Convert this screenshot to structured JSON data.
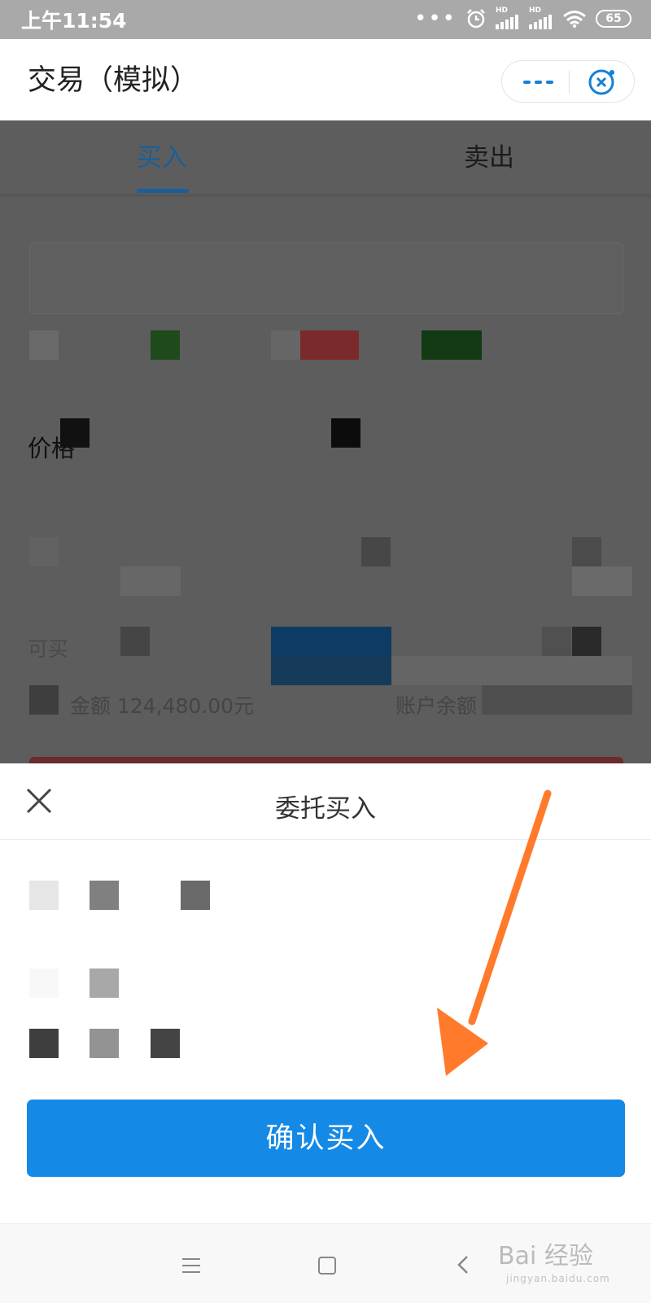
{
  "status_bar": {
    "time": "上午11:54",
    "dots": "•••",
    "signal1": "HD",
    "signal2": "HD",
    "battery": "65"
  },
  "header": {
    "title": "交易（模拟）",
    "more_icon": "more-icon",
    "close_icon": "close-mini-program-icon",
    "accent_color": "#1580d8"
  },
  "tabs": [
    {
      "label": "买入",
      "active": true
    },
    {
      "label": "卖出",
      "active": false
    }
  ],
  "form": {
    "price_label": "价格",
    "qty_label": "可买",
    "amount_text": "金额 124,480.00元",
    "balance_text": "账户余额"
  },
  "sheet": {
    "title": "委托买入",
    "confirm_label": "确认买入",
    "button_color": "#1489e6"
  },
  "watermark": {
    "main": "Bai 经验",
    "sub": "jingyan.baidu.com"
  },
  "annotation": {
    "arrow_color": "#ff7a2b"
  }
}
